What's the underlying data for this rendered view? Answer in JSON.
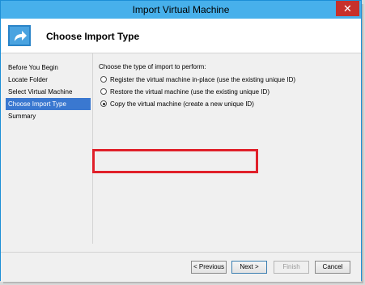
{
  "window": {
    "title": "Import Virtual Machine",
    "close_glyph": "✕"
  },
  "header": {
    "title": "Choose Import Type",
    "icon": "import-arrow-icon"
  },
  "nav": {
    "items": [
      {
        "label": "Before You Begin"
      },
      {
        "label": "Locate Folder"
      },
      {
        "label": "Select Virtual Machine"
      },
      {
        "label": "Choose Import Type"
      },
      {
        "label": "Summary"
      }
    ],
    "active_index": 3
  },
  "content": {
    "prompt": "Choose the type of import to perform:",
    "options": [
      {
        "label": "Register the virtual machine in-place (use the existing unique ID)",
        "selected": false
      },
      {
        "label": "Restore the virtual machine (use the existing unique ID)",
        "selected": false
      },
      {
        "label": "Copy the virtual machine (create a new unique ID)",
        "selected": true
      }
    ]
  },
  "buttons": {
    "previous": "< Previous",
    "next": "Next >",
    "finish": "Finish",
    "cancel": "Cancel"
  },
  "colors": {
    "titlebar": "#47b0eb",
    "nav_active": "#3a78d0",
    "highlight": "#e0202a",
    "close": "#c7312b"
  }
}
